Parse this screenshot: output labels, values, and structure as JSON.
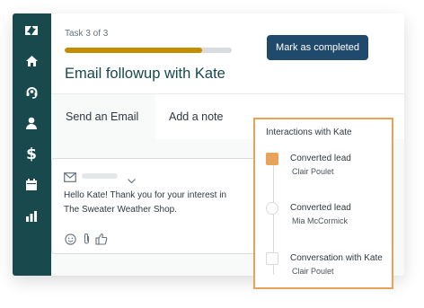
{
  "colors": {
    "sidebar": "#17494d",
    "accent_progress": "#c38f00",
    "button": "#1f4a6b",
    "panel_border": "#e8a35a",
    "marker_filled": "#e8a35a"
  },
  "sidebar": {
    "icons": [
      "zendesk-logo-icon",
      "home-icon",
      "headset-icon",
      "person-icon",
      "dollar-icon",
      "calendar-icon",
      "bar-chart-icon"
    ]
  },
  "task": {
    "progress_label": "Task 3 of 3",
    "progress_fraction": 0.82,
    "title": "Email followup with Kate",
    "complete_button": "Mark as completed"
  },
  "tabs": [
    {
      "label": "Send an Email",
      "active": true
    },
    {
      "label": "Add a note",
      "active": false
    }
  ],
  "email": {
    "body": "Hello Kate! Thank you for your interest in The Sweater Weather Shop."
  },
  "interactions": {
    "title": "Interactions with Kate",
    "items": [
      {
        "title": "Converted lead",
        "person": "Clair Poulet",
        "marker": "filled-square"
      },
      {
        "title": "Converted lead",
        "person": "Mia McCormick",
        "marker": "circle"
      },
      {
        "title": "Conversation with Kate",
        "person": "Clair Poulet",
        "marker": "square"
      }
    ]
  }
}
